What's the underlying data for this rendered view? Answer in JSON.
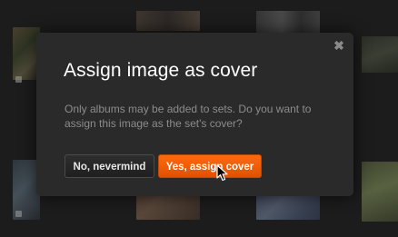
{
  "dialog": {
    "title": "Assign image as cover",
    "message": "Only albums may be added to sets. Do you want to assign this image as the set's cover?",
    "close_glyph": "✖",
    "cancel_label": "No, nevermind",
    "confirm_label": "Yes, assign cover"
  },
  "colors": {
    "accent": "#f25c05",
    "dialog_bg": "#2a2a2a",
    "page_bg": "#1c1c1c"
  },
  "icons": {
    "close": "close-icon",
    "cursor": "mouse-pointer-icon"
  }
}
